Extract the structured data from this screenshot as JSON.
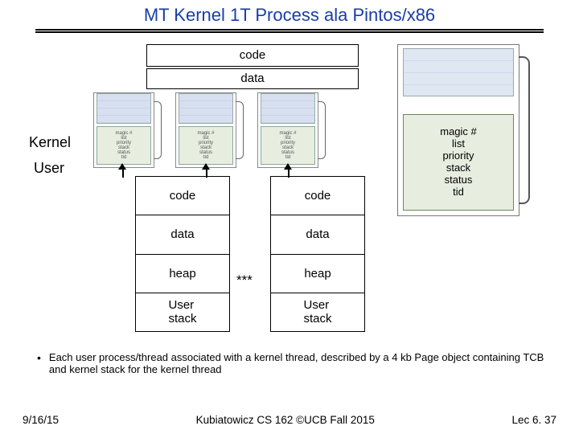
{
  "title": "MT Kernel 1T Process ala Pintos/x86",
  "kernel": {
    "code": "code",
    "data": "data"
  },
  "tcb_fields": [
    "magic #",
    "list",
    "priority",
    "stack",
    "status",
    "tid"
  ],
  "labels": {
    "kernel": "Kernel",
    "user": "User",
    "stars": "***"
  },
  "user_segments": [
    "code",
    "data",
    "heap",
    "User\nstack"
  ],
  "bullet": "Each user process/thread associated with a kernel thread, described by a 4 kb Page object containing TCB and kernel stack for the kernel thread",
  "footer": {
    "date": "9/16/15",
    "mid": "Kubiatowicz CS 162 ©UCB Fall 2015",
    "right": "Lec 6. 37"
  }
}
